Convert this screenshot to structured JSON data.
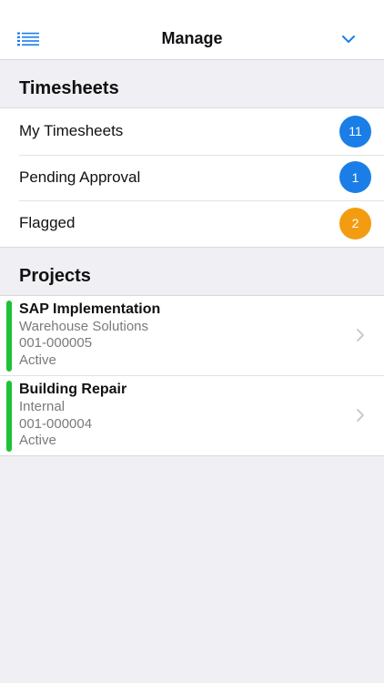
{
  "header": {
    "title": "Manage",
    "menu_icon": "list-menu-icon",
    "dropdown_icon": "chevron-down-icon"
  },
  "timesheets": {
    "heading": "Timesheets",
    "items": [
      {
        "label": "My Timesheets",
        "count": "11",
        "badge_color": "#1a7ee6"
      },
      {
        "label": "Pending Approval",
        "count": "1",
        "badge_color": "#1a7ee6"
      },
      {
        "label": "Flagged",
        "count": "2",
        "badge_color": "#f39c12"
      }
    ]
  },
  "projects": {
    "heading": "Projects",
    "items": [
      {
        "name": "SAP Implementation",
        "client": "Warehouse Solutions",
        "code": "001-000005",
        "status": "Active",
        "status_color": "#1ec23a"
      },
      {
        "name": "Building Repair",
        "client": "Internal",
        "code": "001-000004",
        "status": "Active",
        "status_color": "#1ec23a"
      }
    ]
  },
  "colors": {
    "accent": "#1a7ee6",
    "background": "#efeff4"
  }
}
